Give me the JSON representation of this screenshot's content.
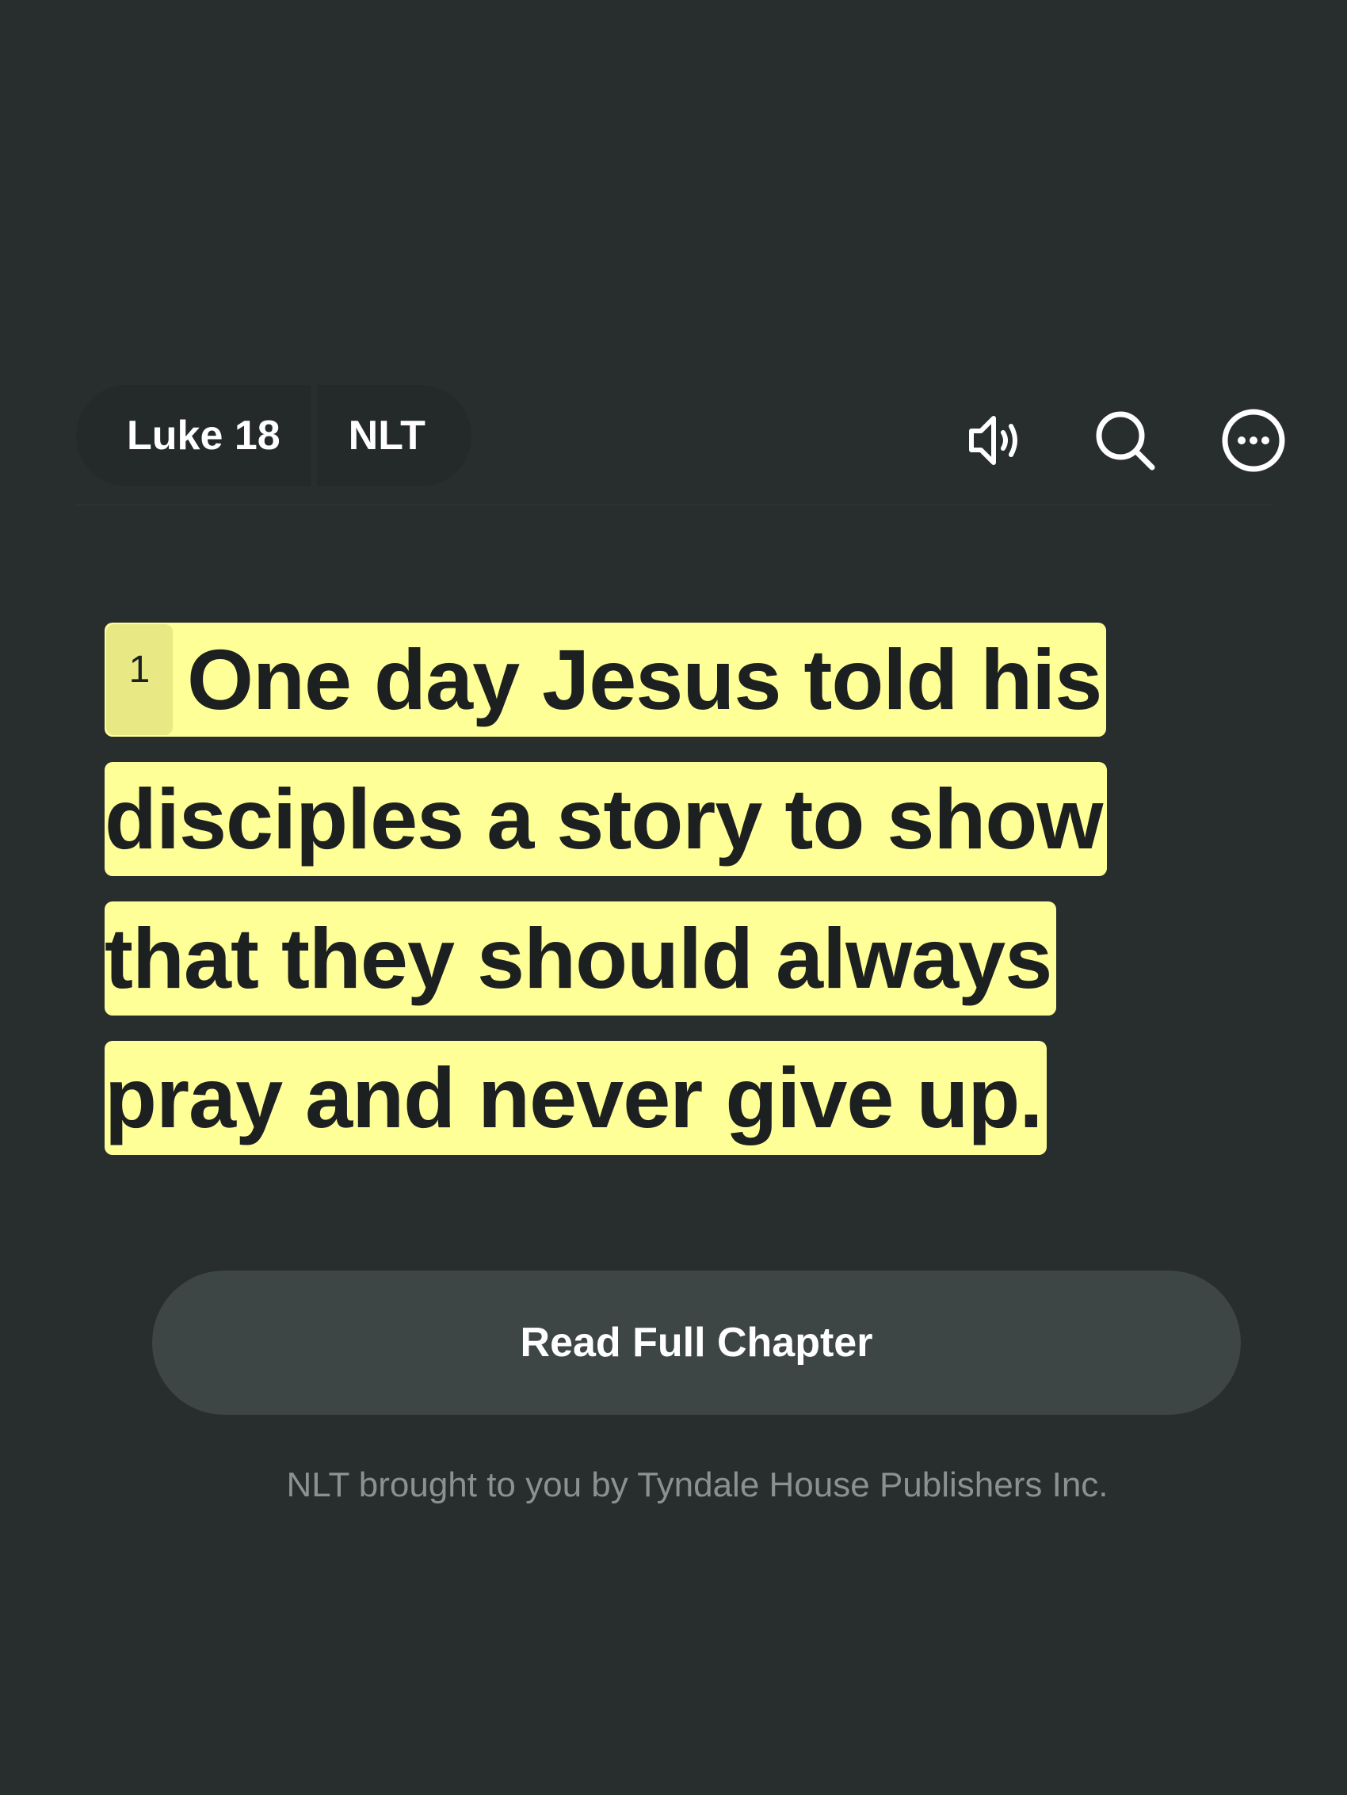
{
  "header": {
    "reference": "Luke 18",
    "version": "NLT",
    "icons": {
      "audio": "speaker-audio-icon",
      "search": "search-icon",
      "more": "more-options-icon"
    }
  },
  "verse": {
    "number": "1",
    "lines": [
      "One day Jesus told his",
      "disciples a story to show",
      "that they should always",
      "pray and never give up."
    ],
    "highlight_color": "#ffff97"
  },
  "read_button": {
    "label": "Read Full Chapter"
  },
  "copyright": "NLT brought to you by Tyndale House Publishers Inc.",
  "colors": {
    "background": "#282e2e",
    "button_background": "#3e4545",
    "text_primary": "#ffffff",
    "text_muted": "#8b9191"
  }
}
